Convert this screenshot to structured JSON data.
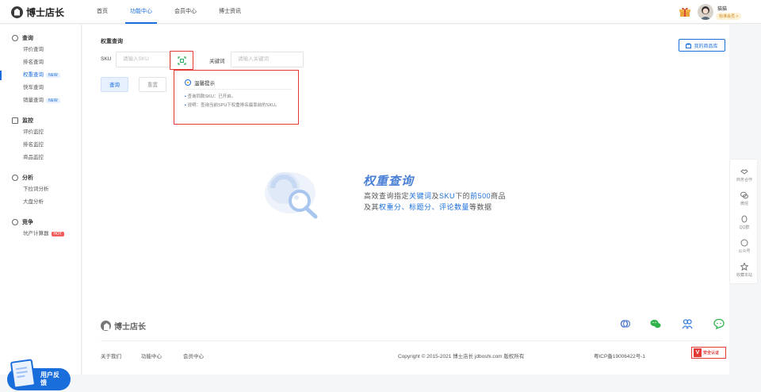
{
  "header": {
    "logo_text": "博士店长",
    "nav": [
      "首页",
      "功能中心",
      "会员中心",
      "博士资讯"
    ],
    "active_nav": 1,
    "user_name": "猫猫",
    "user_badge": "标准会员 >"
  },
  "sidebar": {
    "groups": [
      {
        "title": "查询",
        "icon": "search-icon",
        "items": [
          {
            "label": "评价查询"
          },
          {
            "label": "排名查询"
          },
          {
            "label": "权重查询",
            "tag": "NEW",
            "active": true
          },
          {
            "label": "快车查询"
          },
          {
            "label": "销量查询",
            "tag": "NEW"
          }
        ]
      },
      {
        "title": "监控",
        "icon": "monitor-icon",
        "items": [
          {
            "label": "评价监控"
          },
          {
            "label": "排名监控"
          },
          {
            "label": "商品监控"
          }
        ]
      },
      {
        "title": "分析",
        "icon": "analysis-icon",
        "items": [
          {
            "label": "下拉词分析"
          },
          {
            "label": "大盘分析"
          }
        ]
      },
      {
        "title": "竞争",
        "icon": "compete-icon",
        "items": [
          {
            "label": "坑产计算器",
            "tag": "HOT"
          }
        ]
      }
    ]
  },
  "main": {
    "section_title": "权重查询",
    "sku_label": "SKU",
    "sku_placeholder": "请输入SKU",
    "keyword_label": "关键词",
    "keyword_placeholder": "请输入关键词",
    "query_button": "查询",
    "reset_button": "重置",
    "store_button": "我的商品库"
  },
  "tip": {
    "title": "温馨提示",
    "lines": [
      "查询同款SKU：已开启。",
      "说明：查询当前SPU下权重排名最靠前的SKU。"
    ]
  },
  "empty_state": {
    "title": "权重查询",
    "line1_prefix": "高效查询指定",
    "line1_hl1": "关键词",
    "line1_mid": "及",
    "line1_hl2": "SKU",
    "line1_mid2": "下的",
    "line1_hl3": "前500",
    "line1_suffix": "商品",
    "line2_prefix": "及其",
    "line2_hl1": "权重分、标题分、评论数量",
    "line2_suffix": "等数据"
  },
  "footer": {
    "logo_text": "博士店长",
    "links": [
      "关于我们",
      "功能中心",
      "会员中心"
    ],
    "copyright": "Copyright © 2015-2021 博士店长 jdboshi.com 版权所有",
    "icp": "粤ICP备19006422号-1",
    "auth_label": "安全认证"
  },
  "right_bar": [
    "商务合作",
    "微信",
    "QQ群",
    "公众号",
    "收藏本站"
  ],
  "feedback": {
    "label": "用户反馈"
  }
}
